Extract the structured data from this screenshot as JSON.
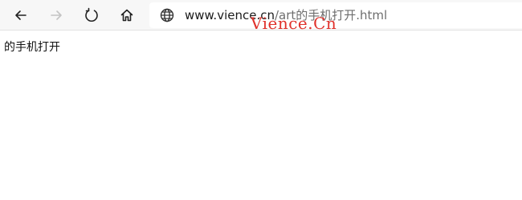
{
  "browser": {
    "url_host": "www.vience.cn",
    "url_path": "/art的手机打开.html",
    "icons": [
      "back-icon",
      "forward-icon",
      "reload-icon",
      "home-icon",
      "globe-icon"
    ]
  },
  "watermark": {
    "text": "Vience.Cn",
    "color": "#e0312b"
  },
  "page": {
    "body_text": "的手机打开"
  }
}
